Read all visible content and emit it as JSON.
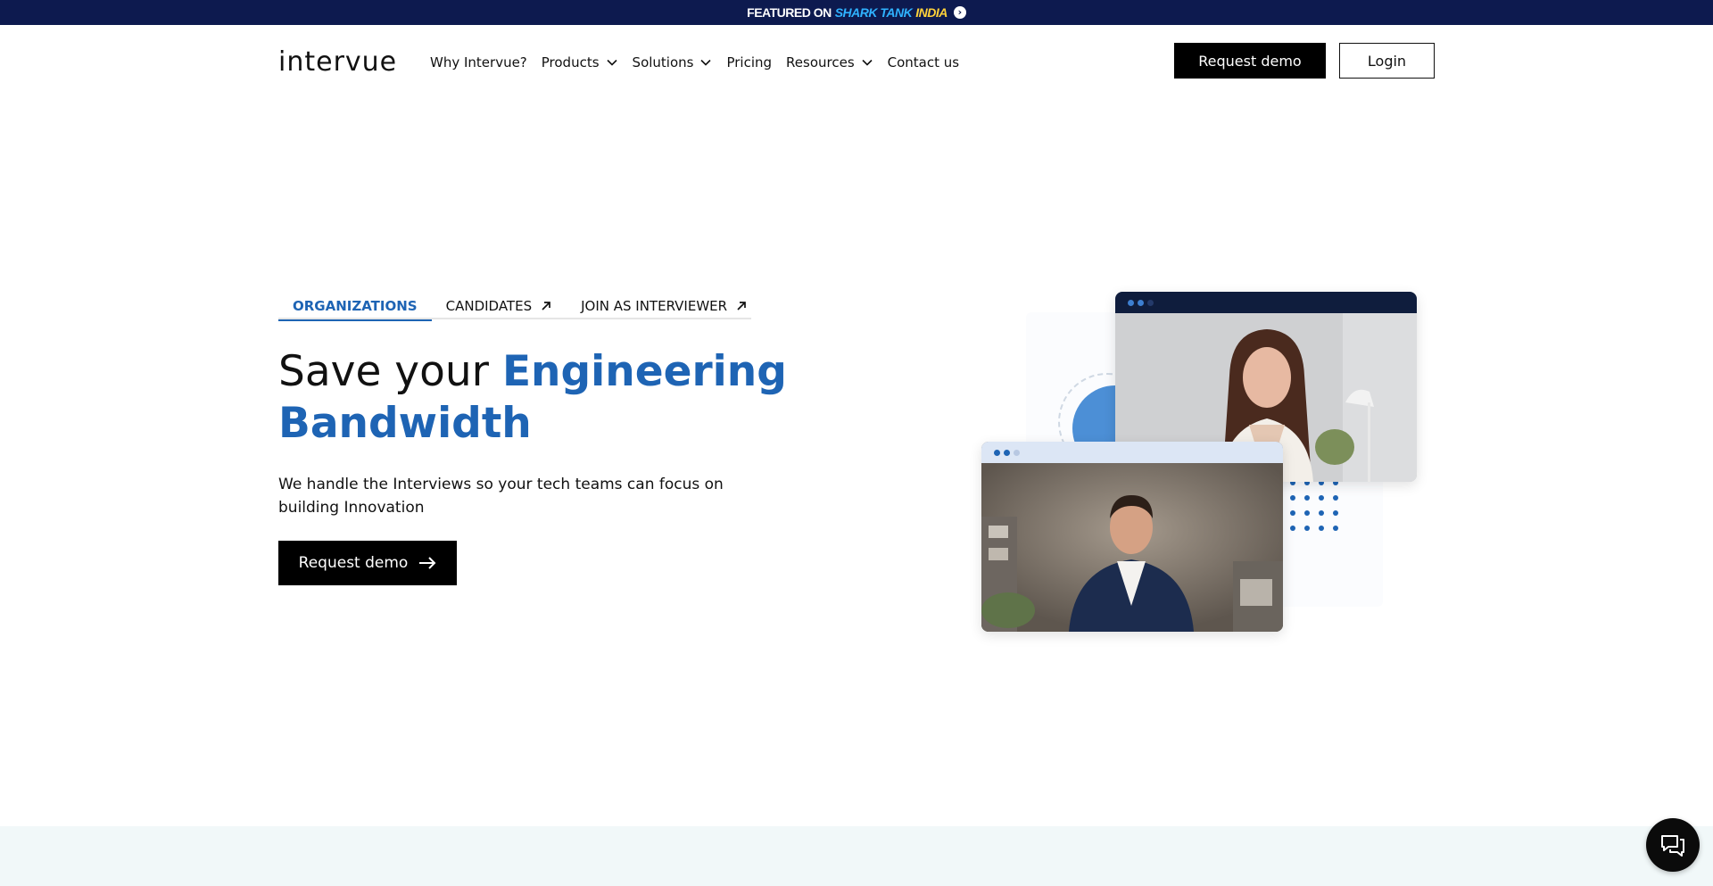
{
  "banner": {
    "featured_on": "FEATURED ON",
    "shark_tank": "SHARK TANK",
    "india": "INDIA",
    "arrow_icon": "arrow-right-circle-icon"
  },
  "header": {
    "logo_text": "intervue",
    "nav": [
      {
        "label": "Why Intervue?",
        "has_dropdown": false
      },
      {
        "label": "Products",
        "has_dropdown": true
      },
      {
        "label": "Solutions",
        "has_dropdown": true
      },
      {
        "label": "Pricing",
        "has_dropdown": false
      },
      {
        "label": "Resources",
        "has_dropdown": true
      },
      {
        "label": "Contact us",
        "has_dropdown": false
      }
    ],
    "request_demo_label": "Request demo",
    "login_label": "Login"
  },
  "hero": {
    "tabs": [
      {
        "label": "ORGANIZATIONS",
        "active": true,
        "external": false
      },
      {
        "label": "CANDIDATES",
        "active": false,
        "external": true
      },
      {
        "label": "JOIN AS INTERVIEWER",
        "active": false,
        "external": true
      }
    ],
    "title_plain": "Save your ",
    "title_highlight": "Engineering Bandwidth",
    "subtitle": "We handle the Interviews so your tech teams can focus on building Innovation",
    "cta_label": "Request demo"
  },
  "colors": {
    "banner_bg": "#0d1a4f",
    "accent_blue": "#1e64b4",
    "primary_button": "#000000",
    "bottom_band": "#f1f8f9"
  },
  "icons": {
    "chat": "chat-bubbles-icon",
    "chevron": "chevron-down-icon",
    "external": "arrow-up-right-icon",
    "cta_arrow": "arrow-right-icon"
  }
}
